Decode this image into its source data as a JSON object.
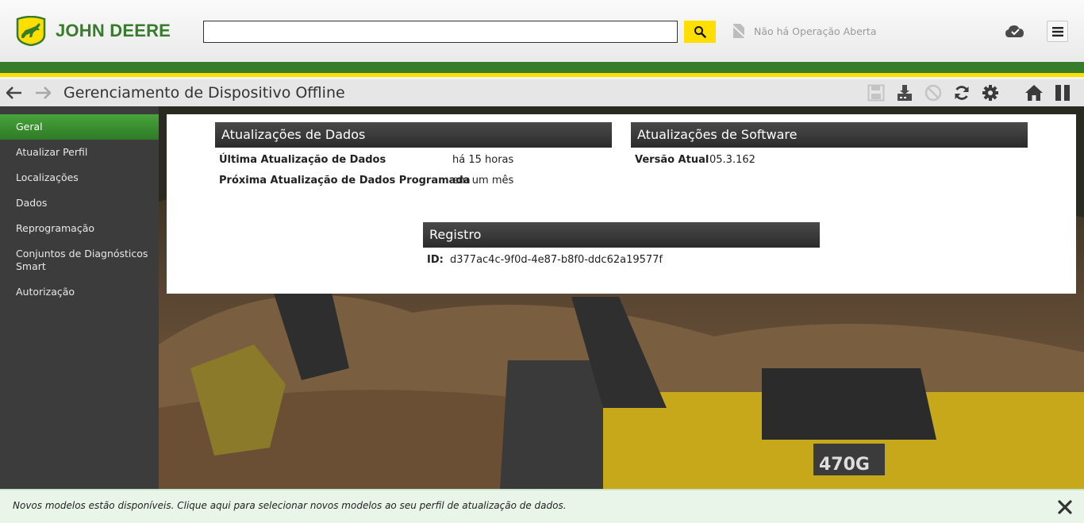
{
  "header": {
    "brand": "JOHN DEERE",
    "search": {
      "value": "",
      "placeholder": ""
    },
    "operation_status": "Não há Operação Aberta"
  },
  "titlebar": {
    "title": "Gerenciamento de Dispositivo Offline"
  },
  "sidebar": {
    "items": [
      {
        "label": "Geral",
        "active": true
      },
      {
        "label": "Atualizar Perfil"
      },
      {
        "label": "Localizações"
      },
      {
        "label": "Dados"
      },
      {
        "label": "Reprogramação"
      },
      {
        "label": "Conjuntos de Diagnósticos Smart"
      },
      {
        "label": "Autorização"
      }
    ]
  },
  "data_updates": {
    "heading": "Atualizações de Dados",
    "last_label": "Última Atualização de Dados",
    "last_value": "há 15 horas",
    "next_label": "Próxima Atualização de Dados Programada",
    "next_value": "em um mês"
  },
  "software_updates": {
    "heading": "Atualizações de Software",
    "version_label": "Versão Atual",
    "version_value": "05.3.162"
  },
  "registry": {
    "heading": "Registro",
    "id_label": "ID:",
    "id_value": "d377ac4c-9f0d-4e87-b8f0-ddc62a19577f"
  },
  "notification": {
    "text": "Novos modelos estão disponíveis. Clique aqui para selecionar novos modelos ao seu perfil de atualização de dados."
  },
  "colors": {
    "brand_green": "#367c2b",
    "brand_yellow": "#ffde00",
    "sidebar_bg": "#3c3c3c",
    "active_green": "#47a33b"
  }
}
